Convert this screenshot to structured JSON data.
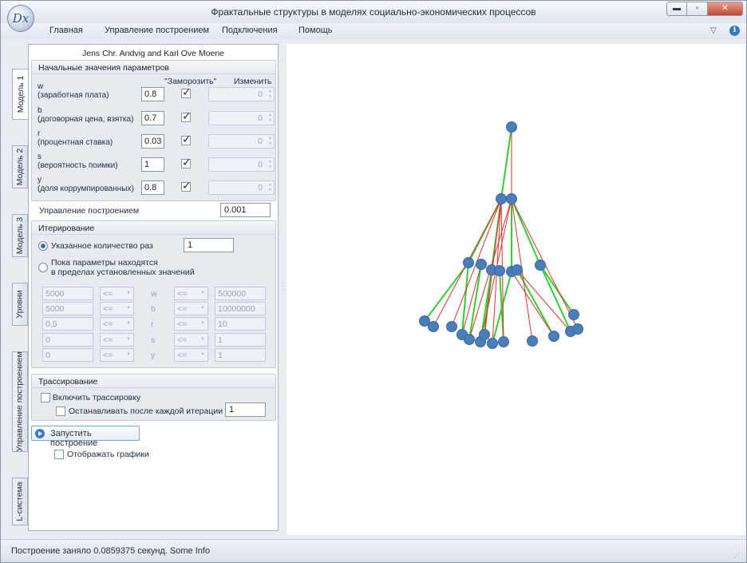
{
  "window": {
    "title": "Фрактальные структуры в моделях социально-экономических процессов",
    "logo_text": "Dx",
    "controls": {
      "minimize": "▬",
      "maximize": "▫",
      "close": "✕"
    }
  },
  "menu": {
    "items": [
      "Главная",
      "Управление построением",
      "Подключения",
      "Помощь"
    ]
  },
  "tabs": [
    "Модель 1",
    "Модель 2",
    "Модель 3",
    "Уровни",
    "Управление построением",
    "L-система"
  ],
  "panel": {
    "authors": "Jens Chr. Andvig and Karl Ove Moene",
    "params_group": {
      "title": "Начальные значения параметров",
      "col_freeze": "\"Заморозить\"",
      "col_change": "Изменить",
      "params": [
        {
          "symbol": "w",
          "desc": "(заработная плата)",
          "value": "0.8",
          "frozen": true,
          "change": "0"
        },
        {
          "symbol": "b",
          "desc": "(договорная цена, взятка)",
          "value": "0.7",
          "frozen": true,
          "change": "0"
        },
        {
          "symbol": "r",
          "desc": "(процентная ставка)",
          "value": "0.03",
          "frozen": true,
          "change": "0"
        },
        {
          "symbol": "s",
          "desc": "(вероятность поимки)",
          "value": "1",
          "frozen": true,
          "change": "0"
        },
        {
          "symbol": "y",
          "desc": "(доля коррумпированных)",
          "value": "0.8",
          "frozen": true,
          "change": "0"
        }
      ]
    },
    "control": {
      "label": "Управление построением",
      "value": "0.001"
    },
    "iter_group": {
      "title": "Итерирование",
      "option_count": "Указанное количество раз",
      "count_value": "1",
      "option_range_line1": "Пока параметры находятся",
      "option_range_line2": "в пределах установленных значений",
      "ranges": [
        {
          "min": "5000",
          "op1": "<=",
          "var": "w",
          "op2": "<=",
          "max": "500000"
        },
        {
          "min": "5000",
          "op1": "<=",
          "var": "b",
          "op2": "<=",
          "max": "10000000"
        },
        {
          "min": "0,5",
          "op1": "<=",
          "var": "r",
          "op2": "<=",
          "max": "10"
        },
        {
          "min": "0",
          "op1": "<=",
          "var": "s",
          "op2": "<=",
          "max": "1"
        },
        {
          "min": "0",
          "op1": "<=",
          "var": "y",
          "op2": "<=",
          "max": "1"
        }
      ]
    },
    "trace_group": {
      "title": "Трассирование",
      "enable": "Включить трассировку",
      "stop_each": "Останавливать после каждой итерации",
      "stop_value": "1"
    },
    "run_button": "Запустить построение",
    "show_graphs": "Отображать графики"
  },
  "status": {
    "text": "Построение заняло 0.0859375 секунд.   Some Info"
  },
  "tree": {
    "node_color": "#4a7ebb",
    "edge_green": "#33cc33",
    "edge_red": "#e03030"
  }
}
